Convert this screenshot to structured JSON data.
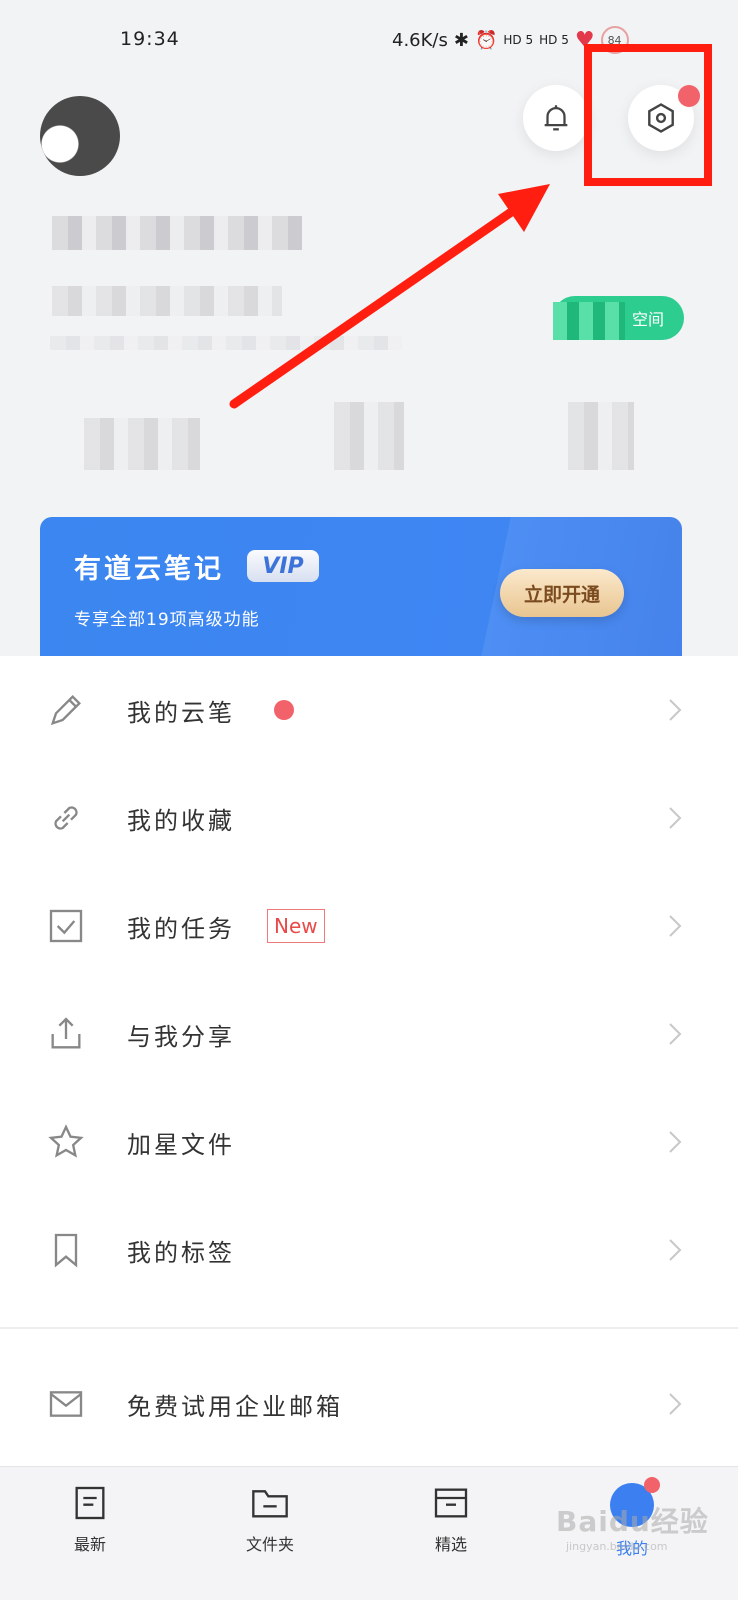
{
  "status_bar": {
    "time": "19:34",
    "net_speed": "4.6K/s",
    "signal_1": "HD 5",
    "signal_2": "HD 5",
    "battery": "84"
  },
  "header": {
    "space_label": "空间"
  },
  "vip": {
    "title": "有道云笔记",
    "badge": "VIP",
    "subtitle": "专享全部19项高级功能",
    "button": "立即开通"
  },
  "menu": {
    "items": [
      {
        "label": "我的云笔",
        "icon": "pencil-icon"
      },
      {
        "label": "我的收藏",
        "icon": "link-icon"
      },
      {
        "label": "我的任务",
        "icon": "checkbox-icon",
        "tag": "New"
      },
      {
        "label": "与我分享",
        "icon": "share-icon"
      },
      {
        "label": "加星文件",
        "icon": "star-icon"
      },
      {
        "label": "我的标签",
        "icon": "bookmark-icon"
      }
    ],
    "mail": {
      "label": "免费试用企业邮箱",
      "icon": "mail-icon"
    }
  },
  "tabs": [
    {
      "label": "最新",
      "icon": "doc-icon"
    },
    {
      "label": "文件夹",
      "icon": "folder-icon"
    },
    {
      "label": "精选",
      "icon": "box-icon"
    },
    {
      "label": "我的",
      "icon": "me-icon",
      "active": true
    }
  ],
  "watermark": {
    "text": "Baidu经验",
    "sub": "jingyan.baidu.com"
  },
  "colors": {
    "accent": "#3b7ff0",
    "notice_dot": "#f2626a",
    "annotation": "#ff1e10",
    "space_green": "#2ccd8f"
  }
}
